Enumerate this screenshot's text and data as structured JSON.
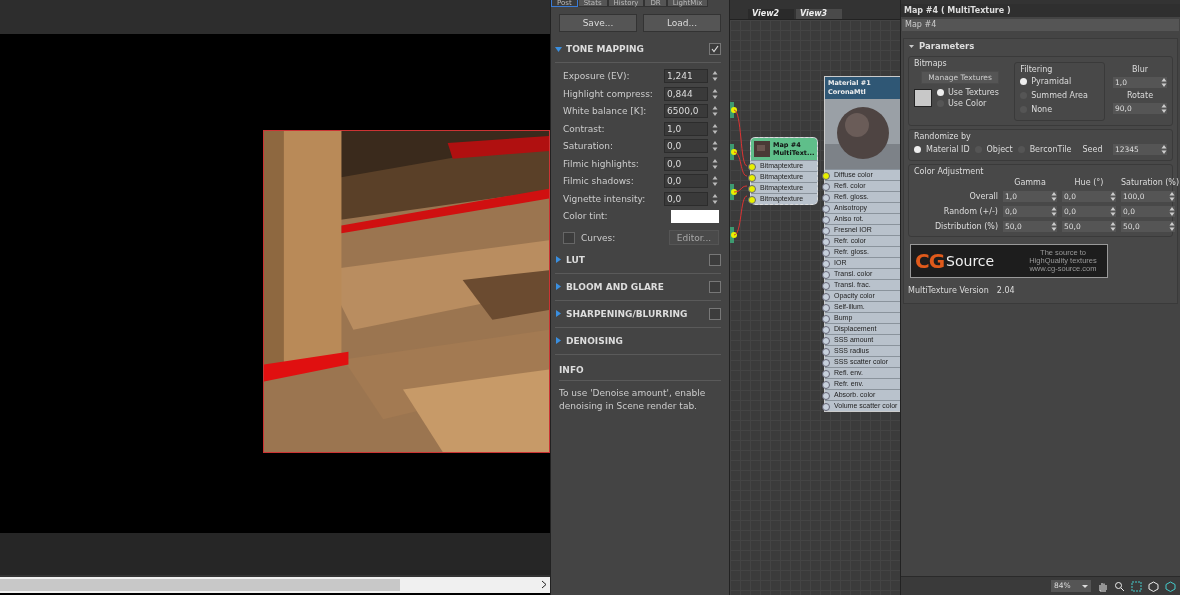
{
  "render_tabs": [
    {
      "label": "Post",
      "selected": true
    },
    {
      "label": "Stats",
      "selected": false
    },
    {
      "label": "History",
      "selected": false
    },
    {
      "label": "DR",
      "selected": false
    },
    {
      "label": "LightMix",
      "selected": false
    }
  ],
  "post": {
    "buttons": [
      "Save...",
      "Load..."
    ],
    "sections": [
      {
        "title": "TONE MAPPING",
        "expanded": true,
        "checked": true,
        "fields": [
          {
            "label": "Exposure (EV):",
            "value": "1,241"
          },
          {
            "label": "Highlight compress:",
            "value": "0,844"
          },
          {
            "label": "White balance [K]:",
            "value": "6500,0"
          },
          {
            "label": "Contrast:",
            "value": "1,0"
          },
          {
            "label": "Saturation:",
            "value": "0,0"
          },
          {
            "label": "Filmic highlights:",
            "value": "0,0"
          },
          {
            "label": "Filmic shadows:",
            "value": "0,0"
          },
          {
            "label": "Vignette intensity:",
            "value": "0,0"
          }
        ],
        "tint_label": "Color tint:",
        "curves": {
          "label": "Curves:",
          "checked": false,
          "button": "Editor...",
          "disabled": true
        }
      },
      {
        "title": "LUT",
        "expanded": false,
        "checked": false
      },
      {
        "title": "BLOOM AND GLARE",
        "expanded": false,
        "checked": false
      },
      {
        "title": "SHARPENING/BLURRING",
        "expanded": false,
        "checked": false
      },
      {
        "title": "DENOISING",
        "expanded": false
      }
    ],
    "info": {
      "title": "INFO",
      "text": "To use 'Denoise amount', enable denoising in Scene render tab."
    }
  },
  "node_editor": {
    "view_tabs": [
      {
        "label": "View2",
        "selected": false
      },
      {
        "label": "View3",
        "selected": true
      }
    ],
    "map_node": {
      "title": "Map #4",
      "subtitle": "MultiText...",
      "inputs": [
        "Bitmaptexture",
        "Bitmaptexture",
        "Bitmaptexture",
        "Bitmaptexture"
      ]
    },
    "material_node": {
      "title": "Material #1",
      "subtitle": "CoronaMtl",
      "slots": [
        "Diffuse color",
        "Refl. color",
        "Refl. gloss.",
        "Anisotropy",
        "Aniso rot.",
        "Fresnel IOR",
        "Refr. color",
        "Refr. gloss.",
        "IOR",
        "Transl. color",
        "Transl. frac.",
        "Opacity color",
        "Self-illum.",
        "Bump",
        "Displacement",
        "SSS amount",
        "SSS radius",
        "SSS scatter color",
        "Refl. env.",
        "Refr. env.",
        "Absorb. color",
        "Volume scatter color"
      ]
    }
  },
  "editor": {
    "title": "Map #4  ( MultiTexture )",
    "name": "Map #4",
    "rollout": "Parameters",
    "bitmaps": {
      "label": "Bitmaps",
      "button": "Manage Textures",
      "source": [
        {
          "label": "Use Textures",
          "selected": true
        },
        {
          "label": "Use Color",
          "selected": false
        }
      ]
    },
    "filtering": {
      "label": "Filtering",
      "options": [
        {
          "label": "Pyramidal",
          "selected": true
        },
        {
          "label": "Summed Area",
          "selected": false
        },
        {
          "label": "None",
          "selected": false
        }
      ]
    },
    "blur": {
      "label": "Blur",
      "value": "1,0"
    },
    "rotate": {
      "label": "Rotate",
      "value": "90,0"
    },
    "randomize": {
      "label": "Randomize by",
      "options": [
        {
          "label": "Material ID",
          "selected": true
        },
        {
          "label": "Object",
          "selected": false
        },
        {
          "label": "BerconTile",
          "selected": false
        }
      ],
      "seed_label": "Seed",
      "seed": "12345"
    },
    "color_adjustment": {
      "label": "Color Adjustment",
      "columns": [
        "Gamma",
        "Hue (°)",
        "Saturation (%)"
      ],
      "rows": [
        {
          "label": "Overall",
          "values": [
            "1,0",
            "0,0",
            "100,0"
          ]
        },
        {
          "label": "Random (+/-)",
          "values": [
            "0,0",
            "0,0",
            "0,0"
          ]
        },
        {
          "label": "Distribution (%)",
          "values": [
            "50,0",
            "50,0",
            "50,0"
          ]
        }
      ]
    },
    "banner": {
      "logo_mark": "CG",
      "logo_word": "Source",
      "tagline": "The source to HighQuality textures www.cg-source.com"
    },
    "version_label": "MultiTexture Version",
    "version": "2.04"
  },
  "status": {
    "zoom": "84%"
  }
}
